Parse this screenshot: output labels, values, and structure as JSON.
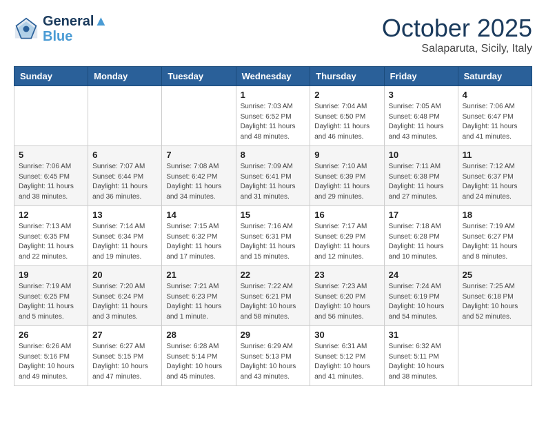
{
  "logo": {
    "line1": "General",
    "line2": "Blue"
  },
  "title": "October 2025",
  "location": "Salaparuta, Sicily, Italy",
  "days_of_week": [
    "Sunday",
    "Monday",
    "Tuesday",
    "Wednesday",
    "Thursday",
    "Friday",
    "Saturday"
  ],
  "weeks": [
    [
      {
        "day": "",
        "info": ""
      },
      {
        "day": "",
        "info": ""
      },
      {
        "day": "",
        "info": ""
      },
      {
        "day": "1",
        "info": "Sunrise: 7:03 AM\nSunset: 6:52 PM\nDaylight: 11 hours\nand 48 minutes."
      },
      {
        "day": "2",
        "info": "Sunrise: 7:04 AM\nSunset: 6:50 PM\nDaylight: 11 hours\nand 46 minutes."
      },
      {
        "day": "3",
        "info": "Sunrise: 7:05 AM\nSunset: 6:48 PM\nDaylight: 11 hours\nand 43 minutes."
      },
      {
        "day": "4",
        "info": "Sunrise: 7:06 AM\nSunset: 6:47 PM\nDaylight: 11 hours\nand 41 minutes."
      }
    ],
    [
      {
        "day": "5",
        "info": "Sunrise: 7:06 AM\nSunset: 6:45 PM\nDaylight: 11 hours\nand 38 minutes."
      },
      {
        "day": "6",
        "info": "Sunrise: 7:07 AM\nSunset: 6:44 PM\nDaylight: 11 hours\nand 36 minutes."
      },
      {
        "day": "7",
        "info": "Sunrise: 7:08 AM\nSunset: 6:42 PM\nDaylight: 11 hours\nand 34 minutes."
      },
      {
        "day": "8",
        "info": "Sunrise: 7:09 AM\nSunset: 6:41 PM\nDaylight: 11 hours\nand 31 minutes."
      },
      {
        "day": "9",
        "info": "Sunrise: 7:10 AM\nSunset: 6:39 PM\nDaylight: 11 hours\nand 29 minutes."
      },
      {
        "day": "10",
        "info": "Sunrise: 7:11 AM\nSunset: 6:38 PM\nDaylight: 11 hours\nand 27 minutes."
      },
      {
        "day": "11",
        "info": "Sunrise: 7:12 AM\nSunset: 6:37 PM\nDaylight: 11 hours\nand 24 minutes."
      }
    ],
    [
      {
        "day": "12",
        "info": "Sunrise: 7:13 AM\nSunset: 6:35 PM\nDaylight: 11 hours\nand 22 minutes."
      },
      {
        "day": "13",
        "info": "Sunrise: 7:14 AM\nSunset: 6:34 PM\nDaylight: 11 hours\nand 19 minutes."
      },
      {
        "day": "14",
        "info": "Sunrise: 7:15 AM\nSunset: 6:32 PM\nDaylight: 11 hours\nand 17 minutes."
      },
      {
        "day": "15",
        "info": "Sunrise: 7:16 AM\nSunset: 6:31 PM\nDaylight: 11 hours\nand 15 minutes."
      },
      {
        "day": "16",
        "info": "Sunrise: 7:17 AM\nSunset: 6:29 PM\nDaylight: 11 hours\nand 12 minutes."
      },
      {
        "day": "17",
        "info": "Sunrise: 7:18 AM\nSunset: 6:28 PM\nDaylight: 11 hours\nand 10 minutes."
      },
      {
        "day": "18",
        "info": "Sunrise: 7:19 AM\nSunset: 6:27 PM\nDaylight: 11 hours\nand 8 minutes."
      }
    ],
    [
      {
        "day": "19",
        "info": "Sunrise: 7:19 AM\nSunset: 6:25 PM\nDaylight: 11 hours\nand 5 minutes."
      },
      {
        "day": "20",
        "info": "Sunrise: 7:20 AM\nSunset: 6:24 PM\nDaylight: 11 hours\nand 3 minutes."
      },
      {
        "day": "21",
        "info": "Sunrise: 7:21 AM\nSunset: 6:23 PM\nDaylight: 11 hours\nand 1 minute."
      },
      {
        "day": "22",
        "info": "Sunrise: 7:22 AM\nSunset: 6:21 PM\nDaylight: 10 hours\nand 58 minutes."
      },
      {
        "day": "23",
        "info": "Sunrise: 7:23 AM\nSunset: 6:20 PM\nDaylight: 10 hours\nand 56 minutes."
      },
      {
        "day": "24",
        "info": "Sunrise: 7:24 AM\nSunset: 6:19 PM\nDaylight: 10 hours\nand 54 minutes."
      },
      {
        "day": "25",
        "info": "Sunrise: 7:25 AM\nSunset: 6:18 PM\nDaylight: 10 hours\nand 52 minutes."
      }
    ],
    [
      {
        "day": "26",
        "info": "Sunrise: 6:26 AM\nSunset: 5:16 PM\nDaylight: 10 hours\nand 49 minutes."
      },
      {
        "day": "27",
        "info": "Sunrise: 6:27 AM\nSunset: 5:15 PM\nDaylight: 10 hours\nand 47 minutes."
      },
      {
        "day": "28",
        "info": "Sunrise: 6:28 AM\nSunset: 5:14 PM\nDaylight: 10 hours\nand 45 minutes."
      },
      {
        "day": "29",
        "info": "Sunrise: 6:29 AM\nSunset: 5:13 PM\nDaylight: 10 hours\nand 43 minutes."
      },
      {
        "day": "30",
        "info": "Sunrise: 6:31 AM\nSunset: 5:12 PM\nDaylight: 10 hours\nand 41 minutes."
      },
      {
        "day": "31",
        "info": "Sunrise: 6:32 AM\nSunset: 5:11 PM\nDaylight: 10 hours\nand 38 minutes."
      },
      {
        "day": "",
        "info": ""
      }
    ]
  ]
}
